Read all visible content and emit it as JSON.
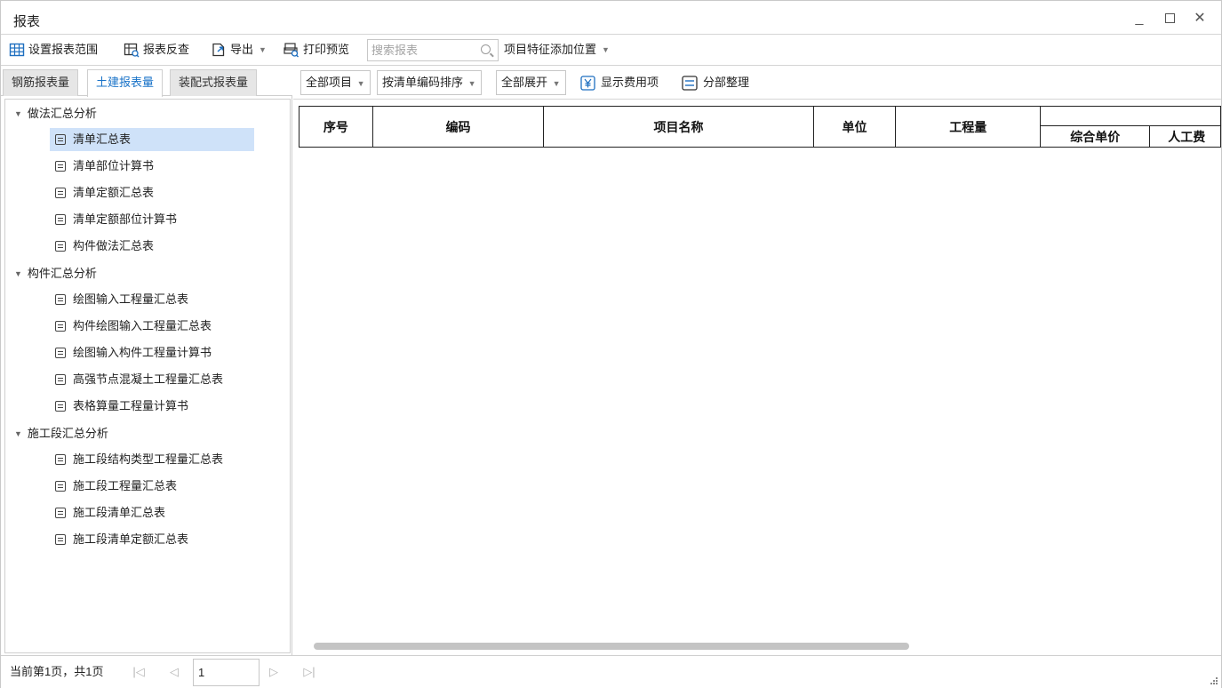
{
  "window": {
    "title": "报表",
    "minimize_glyph": "_",
    "close_glyph": "✕"
  },
  "toolbar": {
    "set_range": "设置报表范围",
    "reverse_check": "报表反查",
    "export": "导出",
    "print_preview": "打印预览",
    "search_placeholder": "搜索报表",
    "add_feature_position": "项目特征添加位置"
  },
  "tabs": [
    {
      "label": "钢筋报表量",
      "active": false
    },
    {
      "label": "土建报表量",
      "active": true
    },
    {
      "label": "装配式报表量",
      "active": false
    }
  ],
  "tree": {
    "groups": [
      {
        "label": "做法汇总分析",
        "items": [
          "清单汇总表",
          "清单部位计算书",
          "清单定额汇总表",
          "清单定额部位计算书",
          "构件做法汇总表"
        ]
      },
      {
        "label": "构件汇总分析",
        "items": [
          "绘图输入工程量汇总表",
          "构件绘图输入工程量汇总表",
          "绘图输入构件工程量计算书",
          "高强节点混凝土工程量汇总表",
          "表格算量工程量计算书"
        ]
      },
      {
        "label": "施工段汇总分析",
        "items": [
          "施工段结构类型工程量汇总表",
          "施工段工程量汇总表",
          "施工段清单汇总表",
          "施工段清单定额汇总表"
        ]
      }
    ],
    "selected": "清单汇总表"
  },
  "subtoolbar": {
    "all_items": "全部项目",
    "sort_by_code": "按清单编码排序",
    "expand_all": "全部展开",
    "show_fee_items": "显示费用项",
    "sectional_organize": "分部整理"
  },
  "table": {
    "headers": {
      "seq": "序号",
      "code": "编码",
      "name": "项目名称",
      "unit": "单位",
      "quantity": "工程量",
      "unit_price": "综合单价",
      "labor": "人工费"
    }
  },
  "statusbar": {
    "page_info": "当前第1页，共1页",
    "page_value": "1"
  },
  "colors": {
    "accent": "#1a73c8",
    "selected_bg": "#cfe2f9",
    "icon_blue": "#1e6fc0"
  }
}
